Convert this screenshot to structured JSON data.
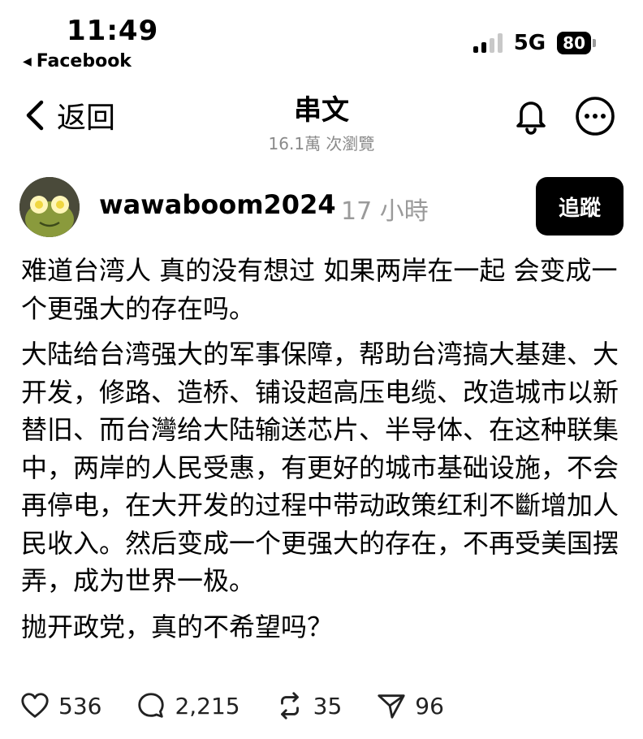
{
  "status_bar": {
    "time": "11:49",
    "back_app": "Facebook",
    "network": "5G",
    "battery": "80"
  },
  "nav": {
    "back_label": "返回",
    "title": "串文",
    "views": "16.1萬 次瀏覽"
  },
  "post": {
    "username": "wawaboom2024",
    "time": "17 小時",
    "follow_label": "追蹤",
    "paragraphs": [
      "难道台湾人 真的没有想过 如果两岸在一起 会变成一个更强大的存在吗。",
      "大陆给台湾强大的军事保障，帮助台湾搞大基建、大开发，修路、造桥、铺设超高压电缆、改造城市以新替旧、而台灣给大陆输送芯片、半导体、在这种联集中，两岸的人民受惠，有更好的城市基础设施，不会再停电，在大开发的过程中带动政策红利不斷增加人民收入。然后变成一个更强大的存在，不再受美国摆弄，成为世界一极。",
      "抛开政党，真的不希望吗？"
    ],
    "likes": "536",
    "comments": "2,215",
    "reposts": "35",
    "shares": "96"
  }
}
